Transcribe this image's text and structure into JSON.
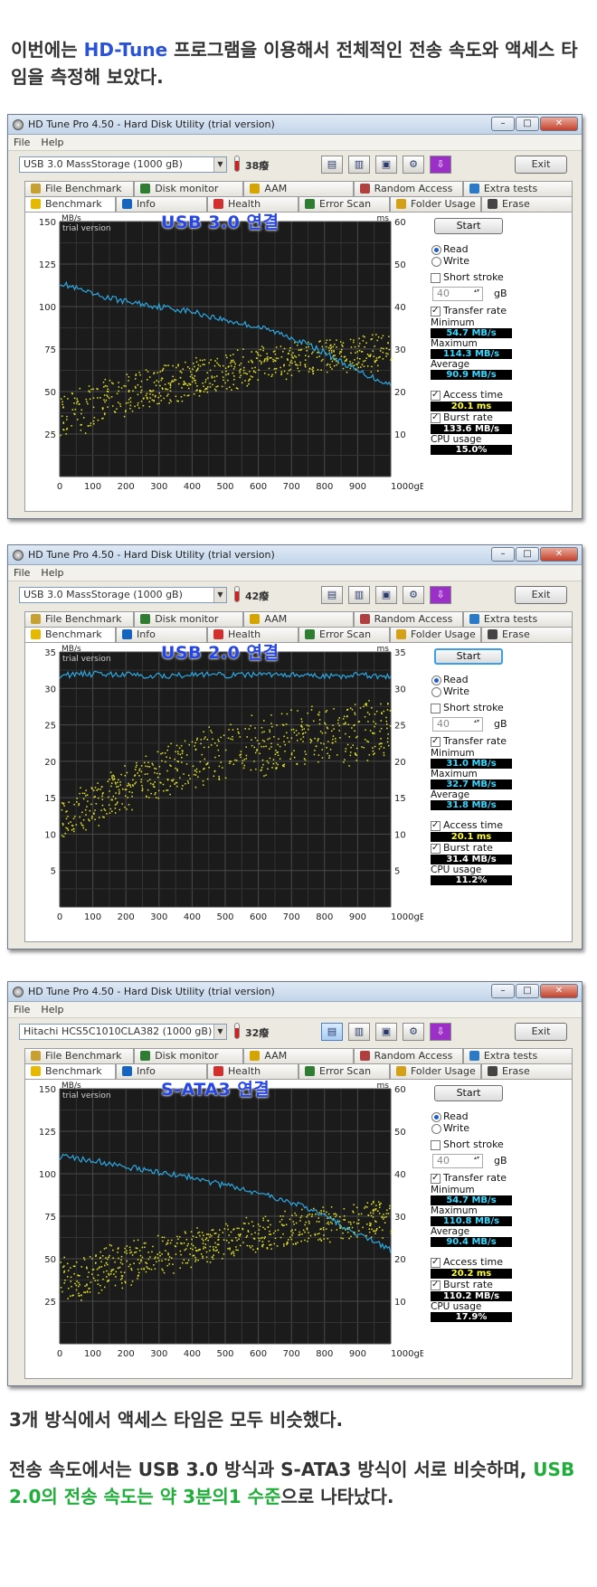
{
  "intro": {
    "text_pre": "이번에는 ",
    "highlight": "HD-Tune",
    "text_post": " 프로그램을 이용해서 전체적인 전송 속도와 액세스 타임을 측정해 보았다."
  },
  "colors": {
    "highlight_blue": "#2a52d8",
    "highlight_green": "#1fae3a",
    "transfer_line": "#2ca7e0",
    "access_dots": "#e6e629"
  },
  "windows": [
    {
      "title": "HD Tune Pro 4.50 - Hard Disk Utility (trial version)",
      "menu": [
        "File",
        "Help"
      ],
      "drive": "USB 3.0 MassStorage      (1000 gB)",
      "temp": "38癈",
      "exit": "Exit",
      "tabs_top": [
        "File Benchmark",
        "Disk monitor",
        "AAM",
        "Random Access",
        "Extra tests"
      ],
      "tabs_bottom": [
        "Benchmark",
        "Info",
        "Health",
        "Error Scan",
        "Folder Usage",
        "Erase"
      ],
      "overlay_label": "USB 3.0 연결",
      "chart": {
        "type": "line",
        "ylabel_left": "MB/s",
        "ylabel_right": "ms",
        "watermark": "trial version",
        "ylim_left": [
          0,
          150
        ],
        "left_ticks": [
          25,
          50,
          75,
          100,
          125,
          150
        ],
        "ylim_right": [
          0,
          60
        ],
        "right_ticks": [
          10,
          20,
          30,
          40,
          50,
          60
        ],
        "xlim": [
          0,
          1000
        ],
        "x_ticks": [
          "0",
          "100",
          "200",
          "300",
          "400",
          "500",
          "600",
          "700",
          "800",
          "900",
          "1000gB"
        ],
        "transfer_series": {
          "x": [
            0,
            100,
            200,
            300,
            400,
            500,
            600,
            700,
            800,
            900,
            1000
          ],
          "y": [
            114,
            107,
            103,
            100,
            97,
            92,
            88,
            82,
            73,
            62,
            54
          ]
        },
        "access_dots": {
          "low": [
            20,
            28,
            35,
            40,
            45,
            50,
            55,
            58,
            60,
            62,
            64
          ],
          "high": [
            52,
            57,
            62,
            66,
            70,
            74,
            77,
            80,
            82,
            84,
            86
          ]
        }
      },
      "side": {
        "start": "Start",
        "read": "Read",
        "write": "Write",
        "short_stroke": "Short stroke",
        "stroke_value": "40",
        "stroke_unit": "gB",
        "transfer_rate": "Transfer rate",
        "minimum_label": "Minimum",
        "minimum": "54.7 MB/s",
        "maximum_label": "Maximum",
        "maximum": "114.3 MB/s",
        "average_label": "Average",
        "average": "90.9 MB/s",
        "access_time_label": "Access time",
        "access_time": "20.1 ms",
        "burst_label": "Burst rate",
        "burst": "133.6 MB/s",
        "cpu_label": "CPU usage",
        "cpu": "15.0%"
      }
    },
    {
      "title": "HD Tune Pro 4.50 - Hard Disk Utility (trial version)",
      "menu": [
        "File",
        "Help"
      ],
      "drive": "USB 3.0 MassStorage      (1000 gB)",
      "temp": "42癈",
      "exit": "Exit",
      "tabs_top": [
        "File Benchmark",
        "Disk monitor",
        "AAM",
        "Random Access",
        "Extra tests"
      ],
      "tabs_bottom": [
        "Benchmark",
        "Info",
        "Health",
        "Error Scan",
        "Folder Usage",
        "Erase"
      ],
      "overlay_label": "USB 2.0 연결",
      "chart": {
        "type": "line",
        "ylabel_left": "MB/s",
        "ylabel_right": "ms",
        "watermark": "trial version",
        "ylim_left": [
          0,
          35
        ],
        "left_ticks": [
          5,
          10,
          15,
          20,
          25,
          30,
          35
        ],
        "ylim_right": [
          0,
          35
        ],
        "right_ticks": [
          5,
          10,
          15,
          20,
          25,
          30,
          35
        ],
        "xlim": [
          0,
          1000
        ],
        "x_ticks": [
          "0",
          "100",
          "200",
          "300",
          "400",
          "500",
          "600",
          "700",
          "800",
          "900",
          "1000gB"
        ],
        "transfer_series": {
          "x": [
            0,
            100,
            200,
            300,
            400,
            500,
            600,
            700,
            800,
            900,
            1000
          ],
          "y": [
            31.8,
            32.0,
            31.9,
            31.7,
            31.9,
            31.8,
            31.9,
            31.8,
            31.6,
            31.9,
            31.5
          ]
        },
        "access_dots": {
          "low": [
            9,
            11,
            13,
            14.5,
            16,
            17,
            18,
            19,
            19.5,
            20,
            20.5
          ],
          "high": [
            15,
            17.5,
            20,
            22,
            24,
            25.5,
            26.5,
            27.5,
            28,
            28.5,
            29
          ]
        }
      },
      "side": {
        "start": "Start",
        "read": "Read",
        "write": "Write",
        "short_stroke": "Short stroke",
        "stroke_value": "40",
        "stroke_unit": "gB",
        "transfer_rate": "Transfer rate",
        "minimum_label": "Minimum",
        "minimum": "31.0 MB/s",
        "maximum_label": "Maximum",
        "maximum": "32.7 MB/s",
        "average_label": "Average",
        "average": "31.8 MB/s",
        "access_time_label": "Access time",
        "access_time": "20.1 ms",
        "burst_label": "Burst rate",
        "burst": "31.4 MB/s",
        "cpu_label": "CPU usage",
        "cpu": "11.2%"
      }
    },
    {
      "title": "HD Tune Pro 4.50 - Hard Disk Utility (trial version)",
      "menu": [
        "File",
        "Help"
      ],
      "drive": "Hitachi HCS5C1010CLA382 (1000 gB)",
      "temp": "32癈",
      "exit": "Exit",
      "tabs_top": [
        "File Benchmark",
        "Disk monitor",
        "AAM",
        "Random Access",
        "Extra tests"
      ],
      "tabs_bottom": [
        "Benchmark",
        "Info",
        "Health",
        "Error Scan",
        "Folder Usage",
        "Erase"
      ],
      "overlay_label": "S-ATA3 연결",
      "chart": {
        "type": "line",
        "ylabel_left": "MB/s",
        "ylabel_right": "ms",
        "watermark": "trial version",
        "ylim_left": [
          0,
          150
        ],
        "left_ticks": [
          25,
          50,
          75,
          100,
          125,
          150
        ],
        "ylim_right": [
          0,
          60
        ],
        "right_ticks": [
          10,
          20,
          30,
          40,
          50,
          60
        ],
        "xlim": [
          0,
          1000
        ],
        "x_ticks": [
          "0",
          "100",
          "200",
          "300",
          "400",
          "500",
          "600",
          "700",
          "800",
          "900",
          "1000gB"
        ],
        "transfer_series": {
          "x": [
            0,
            100,
            200,
            300,
            400,
            500,
            600,
            700,
            800,
            900,
            1000
          ],
          "y": [
            110,
            108,
            104,
            101,
            98,
            93,
            89,
            83,
            75,
            65,
            55
          ]
        },
        "access_dots": {
          "low": [
            20,
            28,
            35,
            40,
            45,
            50,
            54,
            57,
            59,
            61,
            63
          ],
          "high": [
            50,
            56,
            61,
            65,
            69,
            73,
            76,
            79,
            81,
            83,
            85
          ]
        }
      },
      "side": {
        "start": "Start",
        "read": "Read",
        "write": "Write",
        "short_stroke": "Short stroke",
        "stroke_value": "40",
        "stroke_unit": "gB",
        "transfer_rate": "Transfer rate",
        "minimum_label": "Minimum",
        "minimum": "54.7 MB/s",
        "maximum_label": "Maximum",
        "maximum": "110.8 MB/s",
        "average_label": "Average",
        "average": "90.4 MB/s",
        "access_time_label": "Access time",
        "access_time": "20.2 ms",
        "burst_label": "Burst rate",
        "burst": "110.2 MB/s",
        "cpu_label": "CPU usage",
        "cpu": "17.9%"
      }
    }
  ],
  "outro": {
    "line1": "3개 방식에서 액세스 타임은 모두 비슷했다.",
    "line2_pre": "전송 속도에서는 USB 3.0 방식과 S-ATA3 방식이 서로 비슷하며, ",
    "line2_highlight": "USB 2.0의 전송 속도는 약 3분의1 수준",
    "line2_post": "으로 나타났다."
  }
}
